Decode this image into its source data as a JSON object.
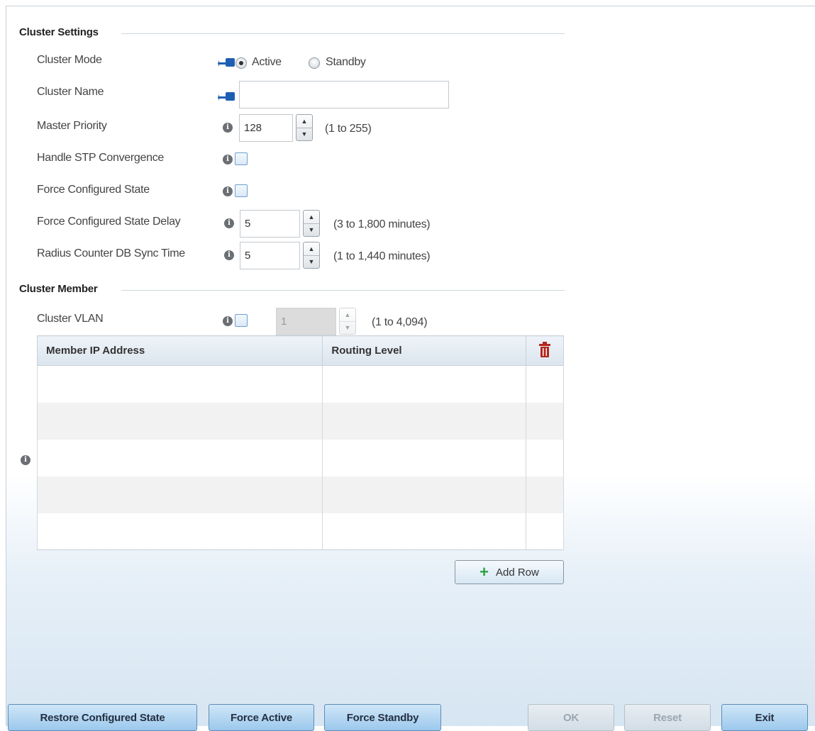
{
  "cluster_settings": {
    "title": "Cluster Settings",
    "cluster_mode": {
      "label": "Cluster Mode",
      "options": [
        "Active",
        "Standby"
      ],
      "selected": "Active"
    },
    "cluster_name": {
      "label": "Cluster Name",
      "value": ""
    },
    "master_priority": {
      "label": "Master Priority",
      "value": "128",
      "hint": "(1 to 255)"
    },
    "handle_stp": {
      "label": "Handle STP Convergence",
      "checked": false
    },
    "force_configured_state": {
      "label": "Force Configured State",
      "checked": false
    },
    "force_configured_state_delay": {
      "label": "Force Configured State Delay",
      "value": "5",
      "hint": "(3 to 1,800 minutes)"
    },
    "radius_counter_db_sync": {
      "label": "Radius Counter DB Sync Time",
      "value": "5",
      "hint": "(1 to 1,440 minutes)"
    }
  },
  "cluster_member": {
    "title": "Cluster Member",
    "cluster_vlan": {
      "label": "Cluster VLAN",
      "checked": false,
      "value": "1",
      "hint": "(1 to 4,094)"
    },
    "table": {
      "columns": [
        "Member IP Address",
        "Routing Level"
      ],
      "rows": []
    },
    "add_row_label": "Add Row"
  },
  "footer": {
    "restore_label": "Restore Configured State",
    "force_active_label": "Force Active",
    "force_standby_label": "Force Standby",
    "ok_label": "OK",
    "reset_label": "Reset",
    "exit_label": "Exit"
  },
  "icons": {
    "info": "info-icon",
    "delete": "trash-icon",
    "override": "pin-override-icon",
    "add": "plus-icon"
  },
  "colors": {
    "accent_blue": "#9cc8ec",
    "delete_red": "#b3261e",
    "add_green": "#2ea043"
  }
}
